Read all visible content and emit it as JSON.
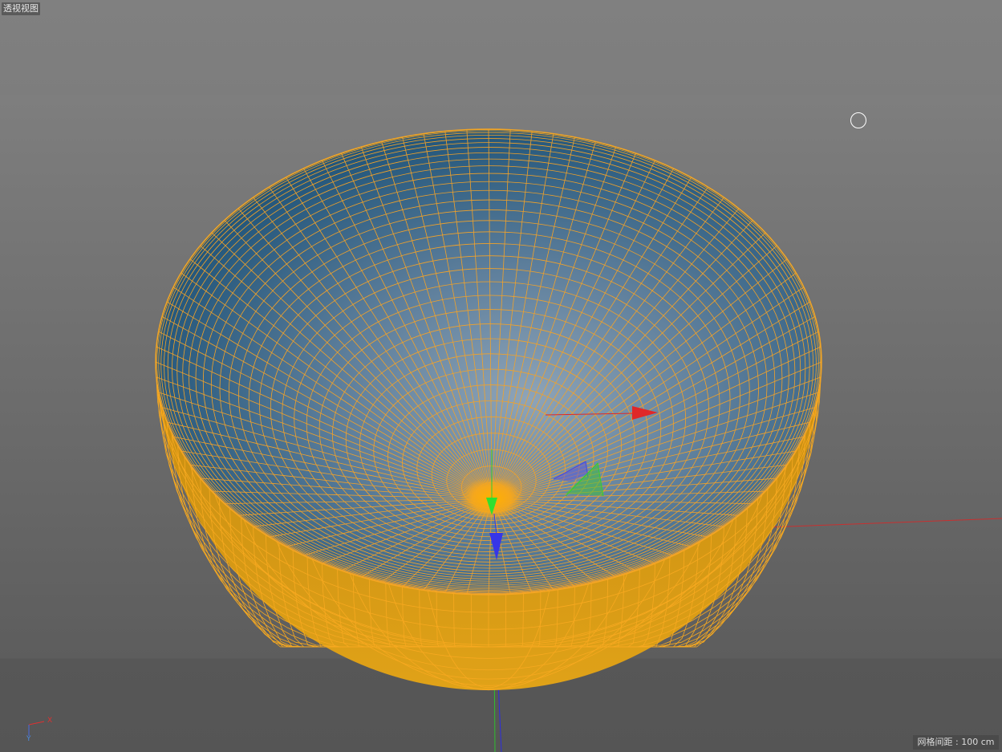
{
  "viewport": {
    "title": "透视视图",
    "grid_spacing": "网格间距 : 100 cm",
    "axes": {
      "x": "X",
      "y": "Y"
    }
  },
  "colors": {
    "wire": "#f5a623",
    "x_axis": "#e02828",
    "y_axis": "#30d030",
    "z_axis": "#3a3ae6",
    "shell": "#d79a12"
  }
}
